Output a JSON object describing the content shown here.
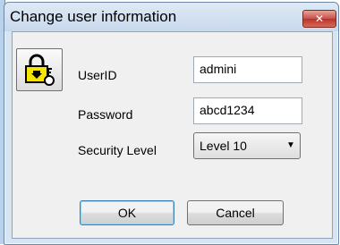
{
  "window": {
    "title": "Change user information",
    "close_label": "✕"
  },
  "form": {
    "userid_label": "UserID",
    "userid_value": "admini",
    "password_label": "Password",
    "password_value": "abcd1234",
    "security_label": "Security Level",
    "security_value": "Level 10"
  },
  "buttons": {
    "ok_label": "OK",
    "cancel_label": "Cancel"
  },
  "icons": {
    "user_key": "lock-key-icon",
    "dropdown": "chevron-down-icon"
  }
}
